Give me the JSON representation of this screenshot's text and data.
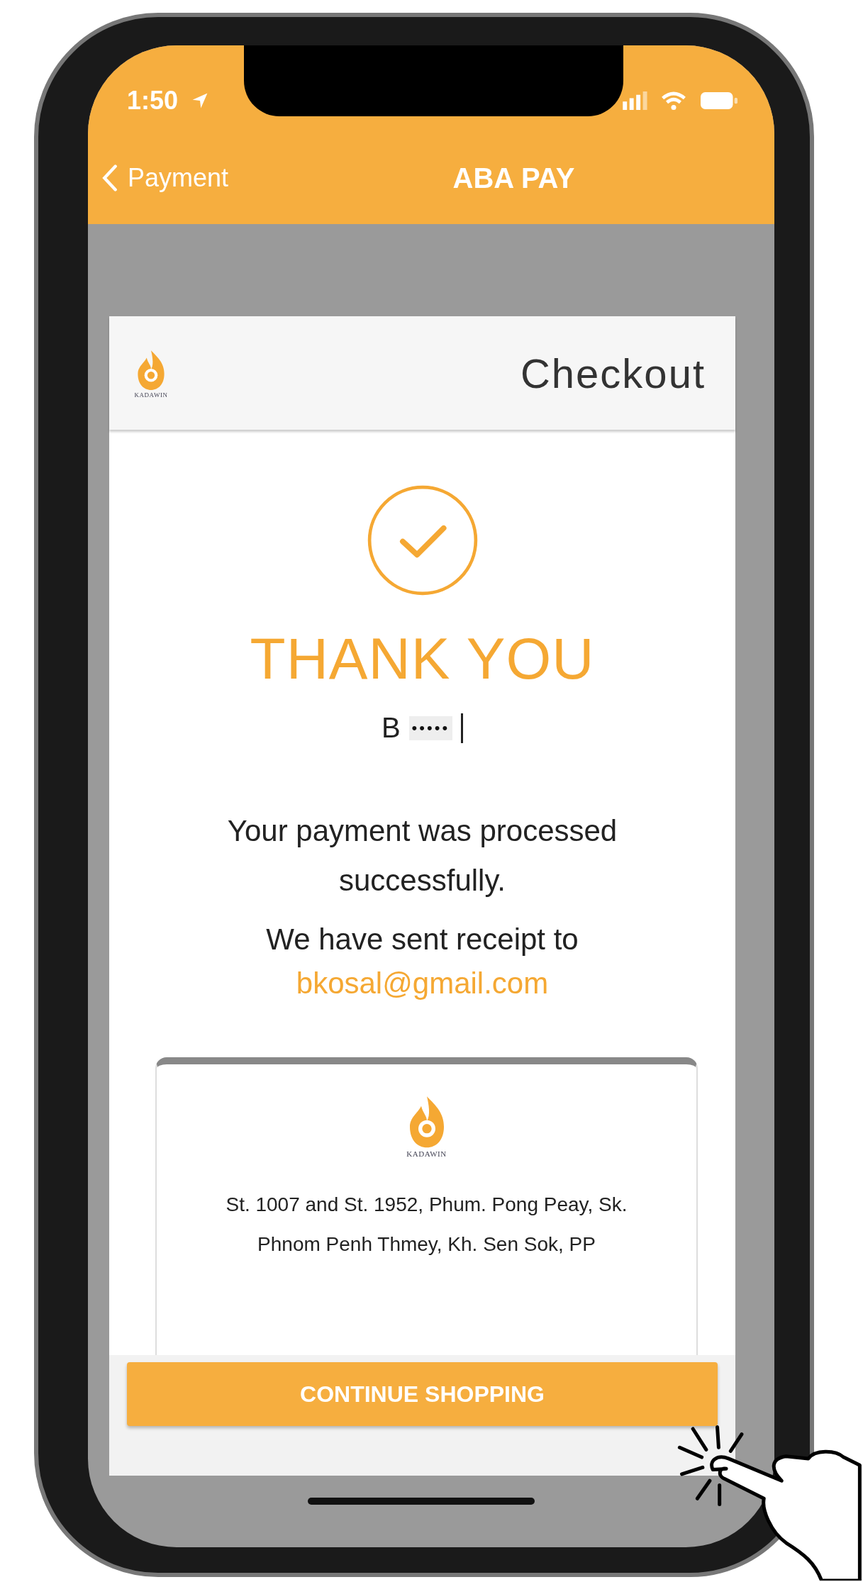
{
  "status_bar": {
    "time": "1:50"
  },
  "nav": {
    "back_label": "Payment",
    "title": "ABA PAY"
  },
  "card_header": {
    "logo_text": "KADAWIN",
    "title": "Checkout"
  },
  "result": {
    "heading": "THANK YOU",
    "name": "B",
    "masked_name": "•••••",
    "message": "Your payment was processed successfully.",
    "receipt_note": "We have sent receipt to",
    "email": "bkosal@gmail.com"
  },
  "receipt": {
    "logo_text": "KADAWIN",
    "address": "St. 1007 and St. 1952, Phum. Pong Peay, Sk. Phnom Penh Thmey, Kh. Sen Sok, PP"
  },
  "button": {
    "label": "CONTINUE SHOPPING"
  }
}
